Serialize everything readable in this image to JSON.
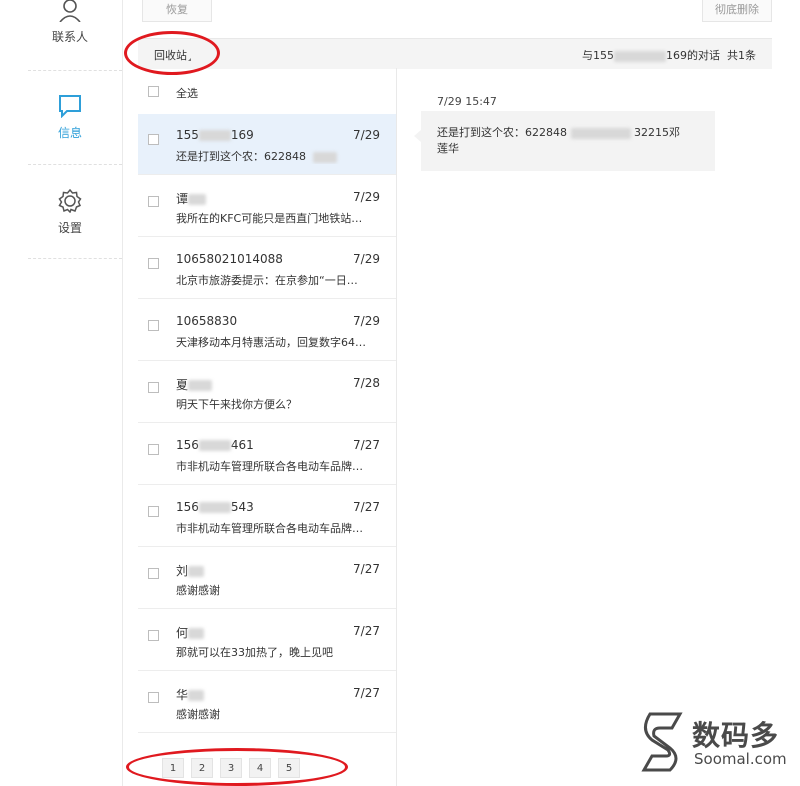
{
  "nav": {
    "items": [
      {
        "label": "联系人",
        "icon": "person-icon",
        "active": false
      },
      {
        "label": "信息",
        "icon": "chat-bubble-icon",
        "active": true
      },
      {
        "label": "设置",
        "icon": "gear-icon",
        "active": false
      }
    ]
  },
  "toolbar": {
    "restore_label": "恢复",
    "delete_forever_label": "彻底删除"
  },
  "header": {
    "folder_label": "回收站",
    "conv_prefix": "与155",
    "conv_suffix": "169的对话",
    "count_label": "共1条"
  },
  "list": {
    "select_all_label": "全选",
    "rows": [
      {
        "name_a": "155",
        "name_b": "169",
        "date": "7/29",
        "preview": "还是打到这个农：622848",
        "selected": true
      },
      {
        "name_a": "谭",
        "name_b": "",
        "date": "7/29",
        "preview": "我所在的KFC可能只是西直门地铁站…"
      },
      {
        "name_a": "10658021014088",
        "name_b": "",
        "date": "7/29",
        "preview": "北京市旅游委提示：在京参加“一日…"
      },
      {
        "name_a": "10658830",
        "name_b": "",
        "date": "7/29",
        "preview": "天津移动本月特惠活动，回复数字64…"
      },
      {
        "name_a": "夏",
        "name_b": "",
        "date": "7/28",
        "preview": "明天下午来找你方便么？"
      },
      {
        "name_a": "156",
        "name_b": "461",
        "date": "7/27",
        "preview": "市非机动车管理所联合各电动车品牌…"
      },
      {
        "name_a": "156",
        "name_b": "543",
        "date": "7/27",
        "preview": "市非机动车管理所联合各电动车品牌…"
      },
      {
        "name_a": "刘",
        "name_b": "",
        "date": "7/27",
        "preview": "感谢感谢"
      },
      {
        "name_a": "何",
        "name_b": "",
        "date": "7/27",
        "preview": "那就可以在33加热了，晚上见吧"
      },
      {
        "name_a": "华",
        "name_b": "",
        "date": "7/27",
        "preview": "感谢感谢"
      }
    ]
  },
  "pagination": {
    "pages": [
      "1",
      "2",
      "3",
      "4",
      "5"
    ]
  },
  "conversation": {
    "time": "7/29 15:47",
    "line1_a": "还是打到这个农：622848",
    "line1_b": "32215邓",
    "line2": "莲华"
  },
  "watermark": {
    "title": "数码多",
    "subtitle": "Soomal.com"
  },
  "colors": {
    "accent": "#2e9fd9",
    "annotation": "#e0191f",
    "selected_row": "#e8f1fb"
  }
}
